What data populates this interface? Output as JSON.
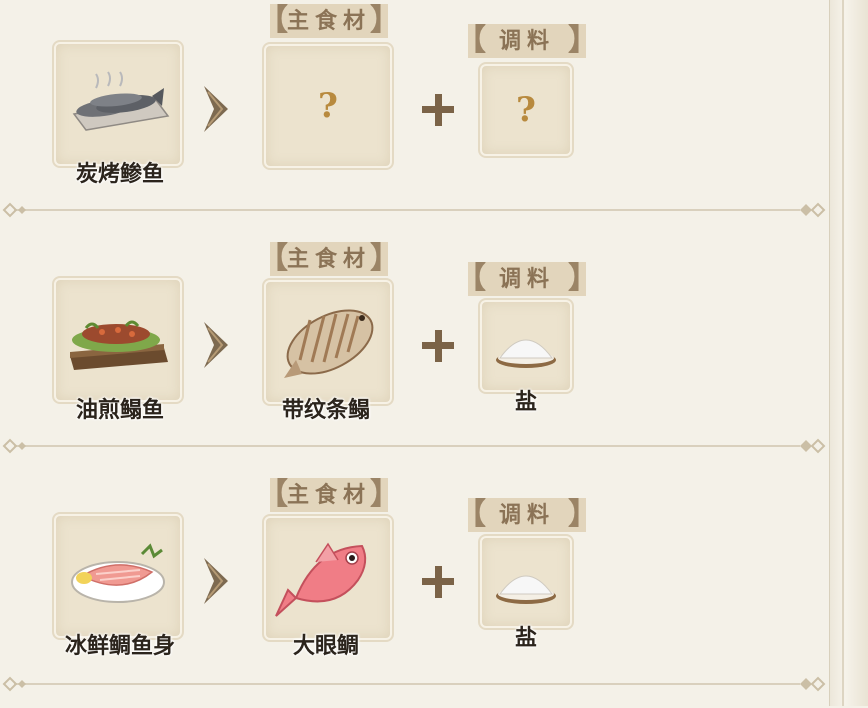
{
  "labels": {
    "main_ingredient_tag": "主食材",
    "seasoning_tag": "调料",
    "unknown_mark": "?"
  },
  "recipes": [
    {
      "dish": "炭烤鲹鱼",
      "dish_icon": "grilled-fish-icon",
      "main_ingredient": "",
      "seasoning": ""
    },
    {
      "dish": "油煎鳎鱼",
      "dish_icon": "pan-fried-sole-icon",
      "main_ingredient": "带纹条鳎",
      "main_icon": "striped-sole-fish-icon",
      "seasoning": "盐",
      "seasoning_icon": "salt-icon"
    },
    {
      "dish": "冰鲜鲷鱼身",
      "dish_icon": "chilled-snapper-fillet-icon",
      "main_ingredient": "大眼鲷",
      "main_icon": "bigeye-snapper-icon",
      "seasoning": "盐",
      "seasoning_icon": "salt-icon"
    }
  ],
  "colors": {
    "background": "#f4f1e8",
    "slot": "#ece3ce",
    "tag_bg": "#e2d5bc",
    "tag_text": "#8b7356",
    "accent": "#8b6a3a"
  }
}
